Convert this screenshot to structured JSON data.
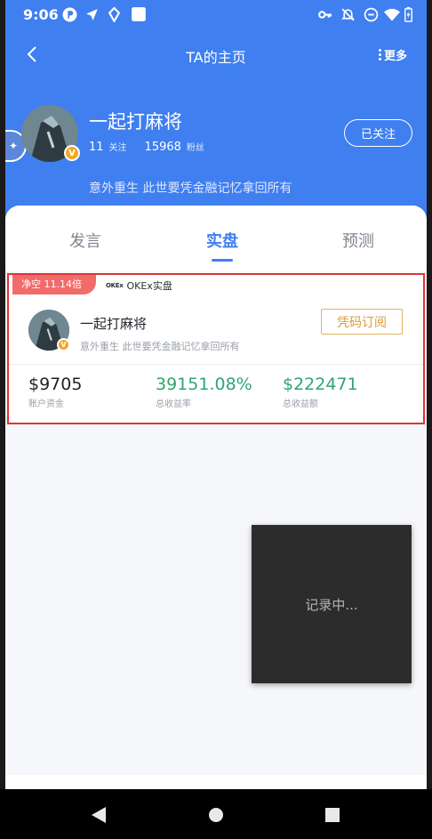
{
  "status_bar": {
    "time": "9:06",
    "icons": [
      "p-icon",
      "navigation-icon",
      "location-pin-icon",
      "square-icon",
      "key-icon",
      "bell-off-icon",
      "do-not-disturb-icon",
      "wifi-icon",
      "battery-icon"
    ]
  },
  "nav": {
    "title": "TA的主页",
    "more_label": "更多"
  },
  "profile": {
    "name": "一起打麻将",
    "following_count": "11",
    "following_label": "关注",
    "followers_count": "15968",
    "followers_label": "粉丝",
    "follow_button": "已关注",
    "bio": "意外重生 此世要凭金融记忆拿回所有"
  },
  "tabs": [
    {
      "label": "发言",
      "active": false
    },
    {
      "label": "实盘",
      "active": true
    },
    {
      "label": "预测",
      "active": false
    }
  ],
  "card": {
    "tag": "净空 11.14倍",
    "exchange_logo": "OKEx",
    "exchange_label": "OKEx实盘",
    "name": "一起打麻将",
    "bio": "意外重生 此世要凭金融记忆拿回所有",
    "subscribe_button": "凭码订阅",
    "metrics": [
      {
        "value": "$9705",
        "label": "账户资金",
        "color": "#1e2227"
      },
      {
        "value": "39151.08%",
        "label": "总收益率",
        "color": "#2fa572"
      },
      {
        "value": "$222471",
        "label": "总收益额",
        "color": "#2fa572"
      }
    ]
  },
  "recording_overlay": {
    "text": "记录中..."
  },
  "colors": {
    "primary": "#3f7ff0",
    "profit": "#2fa572",
    "tag": "#f26b6b",
    "subscribe": "#d79d3a",
    "highlight_border": "#e03434"
  }
}
